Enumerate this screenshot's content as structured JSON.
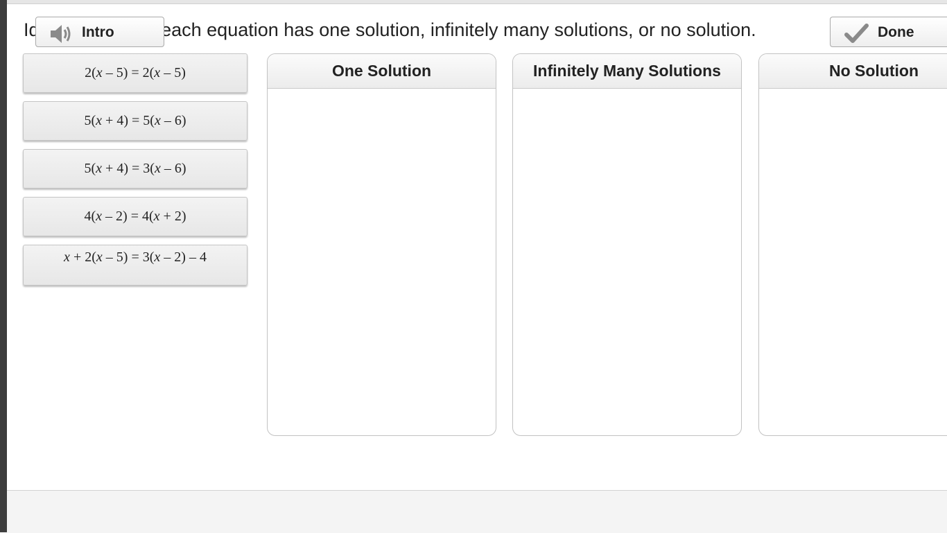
{
  "prompt": "Identify whether each equation has one solution, infinitely many solutions, or no solution.",
  "tiles": [
    {
      "parts": [
        "2(",
        "x",
        " – 5) = 2(",
        "x",
        " – 5)"
      ]
    },
    {
      "parts": [
        "5(",
        "x",
        " + 4) = 5(",
        "x",
        " – 6)"
      ]
    },
    {
      "parts": [
        "5(",
        "x",
        " + 4) = 3(",
        "x",
        " – 6)"
      ]
    },
    {
      "parts": [
        "4(",
        "x",
        " – 2) = 4(",
        "x",
        " + 2)"
      ]
    },
    {
      "parts": [
        "",
        "x",
        " + 2(",
        "x",
        " – 5) = 3(",
        "x",
        " – 2) – 4"
      ]
    }
  ],
  "bins": [
    {
      "label": "One Solution"
    },
    {
      "label": "Infinitely Many Solutions"
    },
    {
      "label": "No Solution"
    }
  ],
  "footer": {
    "intro_label": "Intro",
    "intro_icon": "speaker-icon",
    "done_label": "Done",
    "done_icon": "check-icon"
  }
}
